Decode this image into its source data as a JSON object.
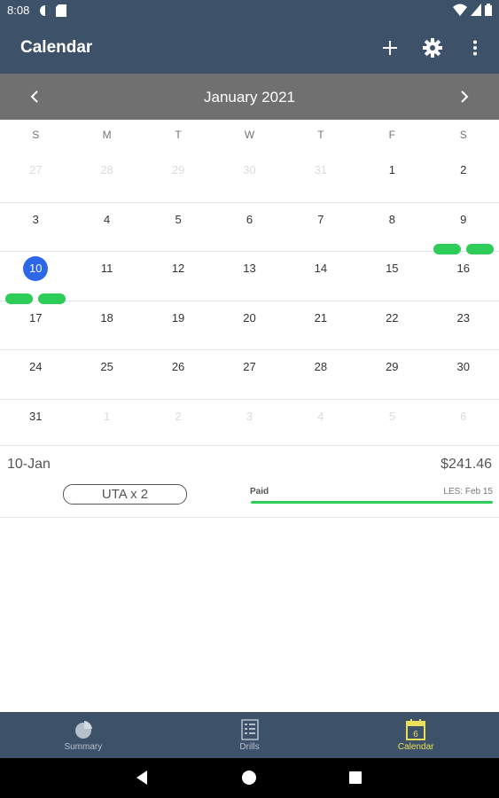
{
  "status_bar": {
    "time": "8:08"
  },
  "app_bar": {
    "title": "Calendar",
    "icons": [
      "add-icon",
      "settings-icon",
      "more-vert-icon"
    ]
  },
  "month_nav": {
    "label": "January  2021"
  },
  "weekdays": [
    "S",
    "M",
    "T",
    "W",
    "T",
    "F",
    "S"
  ],
  "weeks": [
    [
      {
        "d": "27",
        "muted": true
      },
      {
        "d": "28",
        "muted": true
      },
      {
        "d": "29",
        "muted": true
      },
      {
        "d": "30",
        "muted": true
      },
      {
        "d": "31",
        "muted": true
      },
      {
        "d": "1"
      },
      {
        "d": "2"
      }
    ],
    [
      {
        "d": "3"
      },
      {
        "d": "4"
      },
      {
        "d": "5"
      },
      {
        "d": "6"
      },
      {
        "d": "7"
      },
      {
        "d": "8"
      },
      {
        "d": "9",
        "pills": 2
      }
    ],
    [
      {
        "d": "10",
        "selected": true,
        "pills": 2
      },
      {
        "d": "11"
      },
      {
        "d": "12"
      },
      {
        "d": "13"
      },
      {
        "d": "14"
      },
      {
        "d": "15"
      },
      {
        "d": "16"
      }
    ],
    [
      {
        "d": "17"
      },
      {
        "d": "18"
      },
      {
        "d": "19"
      },
      {
        "d": "20"
      },
      {
        "d": "21"
      },
      {
        "d": "22"
      },
      {
        "d": "23"
      }
    ],
    [
      {
        "d": "24"
      },
      {
        "d": "25"
      },
      {
        "d": "26"
      },
      {
        "d": "27"
      },
      {
        "d": "28"
      },
      {
        "d": "29"
      },
      {
        "d": "30"
      }
    ],
    [
      {
        "d": "31"
      },
      {
        "d": "1",
        "muted": true
      },
      {
        "d": "2",
        "muted": true
      },
      {
        "d": "3",
        "muted": true
      },
      {
        "d": "4",
        "muted": true
      },
      {
        "d": "5",
        "muted": true
      },
      {
        "d": "6",
        "muted": true
      }
    ]
  ],
  "detail": {
    "date": "10-Jan",
    "amount": "$241.46",
    "badge": "UTA x 2",
    "paid_label": "Paid",
    "les_label": "LES: Feb 15"
  },
  "bottom_nav": [
    {
      "label": "Summary",
      "icon": "pie-chart-icon",
      "active": false
    },
    {
      "label": "Drills",
      "icon": "list-icon",
      "active": false
    },
    {
      "label": "Calendar",
      "icon": "calendar-icon",
      "active": true
    }
  ],
  "colors": {
    "app_bar": "#3d5169",
    "month_bar": "#707070",
    "selected_day": "#2b67e6",
    "pill": "#2ecc58",
    "active_nav": "#e8e05a"
  }
}
